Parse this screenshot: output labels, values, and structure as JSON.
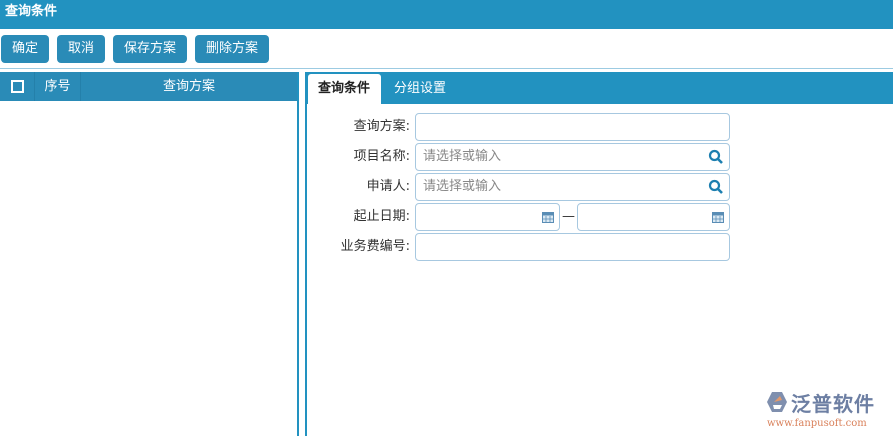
{
  "title": "查询条件",
  "toolbar": {
    "ok": "确定",
    "cancel": "取消",
    "save": "保存方案",
    "delete": "删除方案"
  },
  "grid": {
    "columns": [
      "序号",
      "查询方案"
    ]
  },
  "tabs": [
    "查询条件",
    "分组设置"
  ],
  "form": {
    "scheme_label": "查询方案:",
    "project_label": "项目名称:",
    "project_placeholder": "请选择或输入",
    "applicant_label": "申请人:",
    "applicant_placeholder": "请选择或输入",
    "date_label": "起止日期:",
    "date_sep": "—",
    "fee_label": "业务费编号:"
  },
  "logo": {
    "name": "泛普软件",
    "url": "www.fanpusoft.com"
  }
}
